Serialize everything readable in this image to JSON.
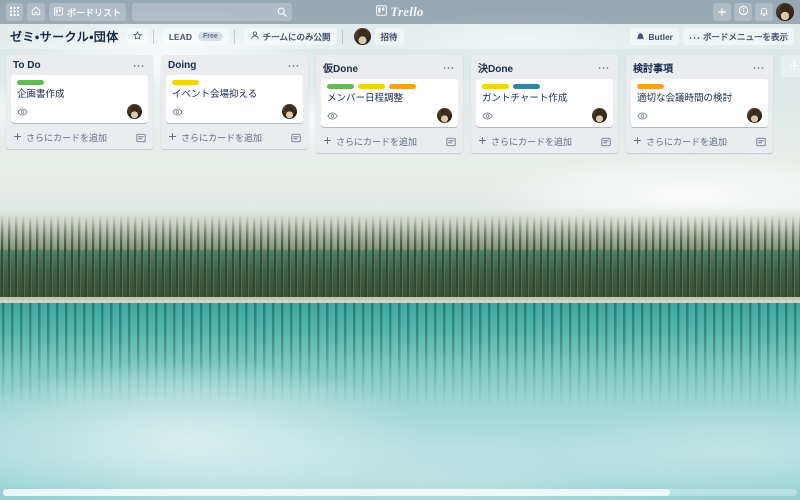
{
  "top_nav": {
    "boards_grid_icon": "apps-grid-icon",
    "home_icon": "home-icon",
    "boards_button_label": "ボードリスト",
    "boards_button_icon": "board-icon",
    "search": {
      "value": "",
      "placeholder": "",
      "icon": "search-icon"
    },
    "brand": "Trello",
    "add_icon": "plus-icon",
    "info_icon": "info-icon",
    "notifications_icon": "bell-icon",
    "avatar": "user-avatar"
  },
  "board_header": {
    "title": "ゼミ・サークル・団体",
    "star_icon": "star-icon",
    "team_name": "LEAD",
    "plan_badge": "Free",
    "visibility_icon": "team-icon",
    "visibility_label": "チームにのみ公開",
    "member_avatar": "member-avatar",
    "invite_label": "招待",
    "butler_icon": "butler-icon",
    "butler_label": "Butler",
    "menu_icon": "ellipsis-icon",
    "menu_label": "ボードメニューを表示"
  },
  "label_colors": {
    "green": "#61bd4f",
    "yellow": "#f2d600",
    "orange": "#ff9f1a",
    "blue": "#2b8ba7"
  },
  "lists": [
    {
      "title": "To Do",
      "menu_icon": "ellipsis-icon",
      "cards": [
        {
          "labels": [
            "green"
          ],
          "title": "企画書作成",
          "watch_icon": "eye-icon",
          "avatar": "member-avatar"
        }
      ],
      "add_card_icon": "plus-icon",
      "add_card_label": "さらにカードを追加",
      "template_icon": "card-template-icon"
    },
    {
      "title": "Doing",
      "menu_icon": "ellipsis-icon",
      "cards": [
        {
          "labels": [
            "yellow"
          ],
          "title": "イベント会場抑える",
          "watch_icon": "eye-icon",
          "avatar": "member-avatar"
        }
      ],
      "add_card_icon": "plus-icon",
      "add_card_label": "さらにカードを追加",
      "template_icon": "card-template-icon"
    },
    {
      "title": "仮Done",
      "menu_icon": "ellipsis-icon",
      "cards": [
        {
          "labels": [
            "green",
            "yellow",
            "orange"
          ],
          "title": "メンバー日程調整",
          "watch_icon": "eye-icon",
          "avatar": "member-avatar"
        }
      ],
      "add_card_icon": "plus-icon",
      "add_card_label": "さらにカードを追加",
      "template_icon": "card-template-icon"
    },
    {
      "title": "決Done",
      "menu_icon": "ellipsis-icon",
      "cards": [
        {
          "labels": [
            "yellow",
            "blue"
          ],
          "title": "ガントチャート作成",
          "watch_icon": "eye-icon",
          "avatar": "member-avatar"
        }
      ],
      "add_card_icon": "plus-icon",
      "add_card_label": "さらにカードを追加",
      "template_icon": "card-template-icon"
    },
    {
      "title": "検討事項",
      "menu_icon": "ellipsis-icon",
      "cards": [
        {
          "labels": [
            "orange"
          ],
          "title": "適切な会議時間の検討",
          "watch_icon": "eye-icon",
          "avatar": "member-avatar"
        }
      ],
      "add_card_icon": "plus-icon",
      "add_card_label": "さらにカードを追加",
      "template_icon": "card-template-icon"
    }
  ],
  "add_list_icon": "plus-icon",
  "scrollbar": {
    "name": "horizontal-scrollbar"
  }
}
